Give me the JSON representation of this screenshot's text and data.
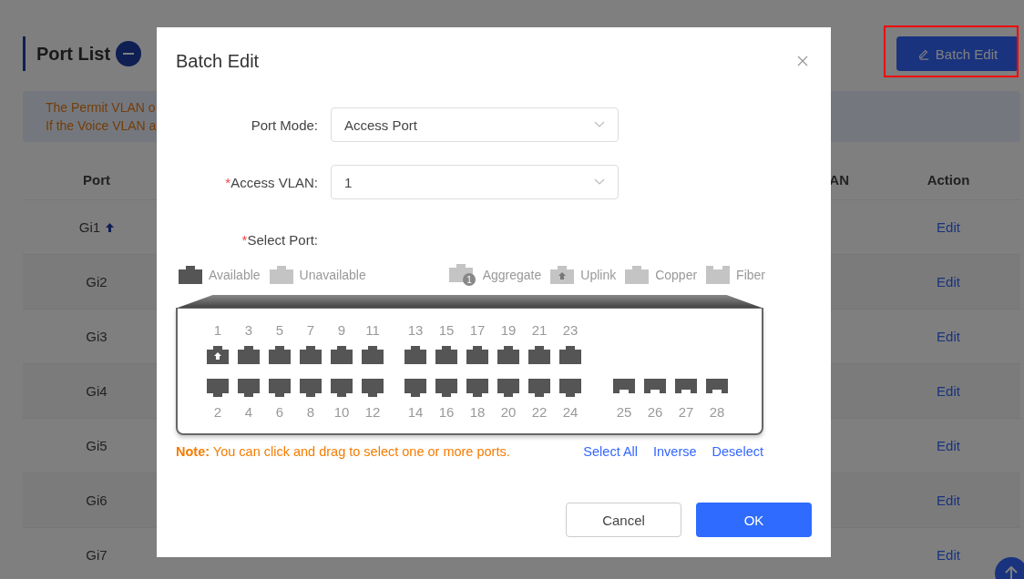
{
  "page": {
    "title": "Port List",
    "batch_button": "Batch Edit",
    "banner": [
      "The Permit VLAN o",
      "If the Voice VLAN a"
    ],
    "columns": [
      "Port",
      "AN",
      "Action"
    ],
    "rows": [
      {
        "port": "Gi1",
        "uplink": true,
        "action": "Edit"
      },
      {
        "port": "Gi2",
        "uplink": false,
        "action": "Edit"
      },
      {
        "port": "Gi3",
        "uplink": false,
        "action": "Edit"
      },
      {
        "port": "Gi4",
        "uplink": false,
        "action": "Edit"
      },
      {
        "port": "Gi5",
        "uplink": false,
        "action": "Edit"
      },
      {
        "port": "Gi6",
        "uplink": false,
        "action": "Edit"
      },
      {
        "port": "Gi7",
        "uplink": false,
        "action": "Edit"
      }
    ]
  },
  "dialog": {
    "title": "Batch Edit",
    "fields": [
      {
        "label": "Port Mode:",
        "value": "Access Port"
      },
      {
        "required_mark": "*",
        "label": "Access VLAN:",
        "value": "1"
      }
    ],
    "select_port": {
      "required_mark": "*",
      "label": "Select Port:"
    },
    "legend": [
      {
        "kind": "available",
        "label": "Available"
      },
      {
        "kind": "unavailable",
        "label": "Unavailable"
      },
      {
        "kind": "aggregate",
        "label": "Aggregate",
        "badge": "1"
      },
      {
        "kind": "uplink",
        "label": "Uplink"
      },
      {
        "kind": "copper",
        "label": "Copper"
      },
      {
        "kind": "fiber",
        "label": "Fiber"
      }
    ],
    "port_groups": [
      {
        "columns": [
          {
            "top": {
              "number": "1",
              "available": true,
              "uplink": true
            },
            "bottom": {
              "number": "2",
              "available": true,
              "uplink": false
            }
          },
          {
            "top": {
              "number": "3",
              "available": true,
              "uplink": false
            },
            "bottom": {
              "number": "4",
              "available": true,
              "uplink": false
            }
          },
          {
            "top": {
              "number": "5",
              "available": true,
              "uplink": false
            },
            "bottom": {
              "number": "6",
              "available": true,
              "uplink": false
            }
          },
          {
            "top": {
              "number": "7",
              "available": true,
              "uplink": false
            },
            "bottom": {
              "number": "8",
              "available": true,
              "uplink": false
            }
          },
          {
            "top": {
              "number": "9",
              "available": true,
              "uplink": false
            },
            "bottom": {
              "number": "10",
              "available": true,
              "uplink": false
            }
          },
          {
            "top": {
              "number": "11",
              "available": true,
              "uplink": false
            },
            "bottom": {
              "number": "12",
              "available": true,
              "uplink": false
            }
          }
        ]
      },
      {
        "columns": [
          {
            "top": {
              "number": "13",
              "available": true,
              "uplink": false
            },
            "bottom": {
              "number": "14",
              "available": true,
              "uplink": false
            }
          },
          {
            "top": {
              "number": "15",
              "available": true,
              "uplink": false
            },
            "bottom": {
              "number": "16",
              "available": true,
              "uplink": false
            }
          },
          {
            "top": {
              "number": "17",
              "available": true,
              "uplink": false
            },
            "bottom": {
              "number": "18",
              "available": true,
              "uplink": false
            }
          },
          {
            "top": {
              "number": "19",
              "available": true,
              "uplink": false
            },
            "bottom": {
              "number": "20",
              "available": true,
              "uplink": false
            }
          },
          {
            "top": {
              "number": "21",
              "available": true,
              "uplink": false
            },
            "bottom": {
              "number": "22",
              "available": true,
              "uplink": false
            }
          },
          {
            "top": {
              "number": "23",
              "available": true,
              "uplink": false
            },
            "bottom": {
              "number": "24",
              "available": true,
              "uplink": false
            }
          }
        ]
      },
      {
        "kind": "fiber",
        "columns": [
          {
            "bottom": {
              "number": "25",
              "available": true,
              "uplink": false
            }
          },
          {
            "bottom": {
              "number": "26",
              "available": true,
              "uplink": false
            }
          },
          {
            "bottom": {
              "number": "27",
              "available": true,
              "uplink": false
            }
          },
          {
            "bottom": {
              "number": "28",
              "available": true,
              "uplink": false
            }
          }
        ]
      }
    ],
    "note": "**Note:** You can click and drag to select one or more ports.",
    "links": [
      "Select All",
      "Inverse",
      "Deselect"
    ],
    "buttons": [
      {
        "kind": "secondary",
        "label": "Cancel"
      },
      {
        "kind": "primary",
        "label": "OK"
      }
    ]
  }
}
